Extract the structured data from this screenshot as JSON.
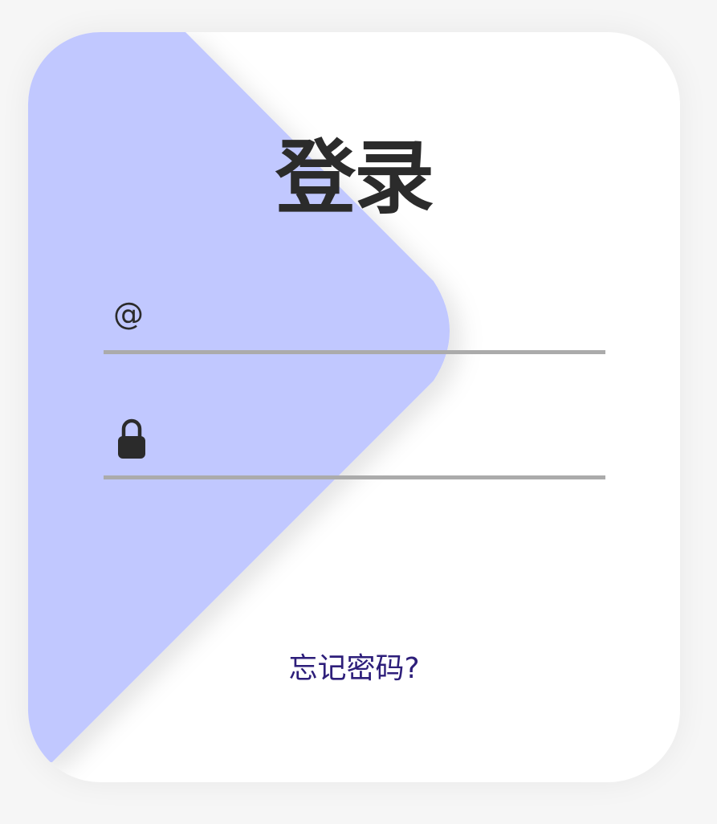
{
  "login": {
    "title": "登录",
    "email_icon": "@",
    "email_value": "",
    "email_placeholder": "",
    "password_icon": "lock-icon",
    "password_value": "",
    "password_placeholder": "",
    "forgot_link": "忘记密码?"
  },
  "colors": {
    "background": "#f6f6f6",
    "card": "#ffffff",
    "accent_shape": "#c1c8ff",
    "title": "#2b2b2b",
    "underline": "#ababab",
    "link": "#2d1e7a"
  }
}
